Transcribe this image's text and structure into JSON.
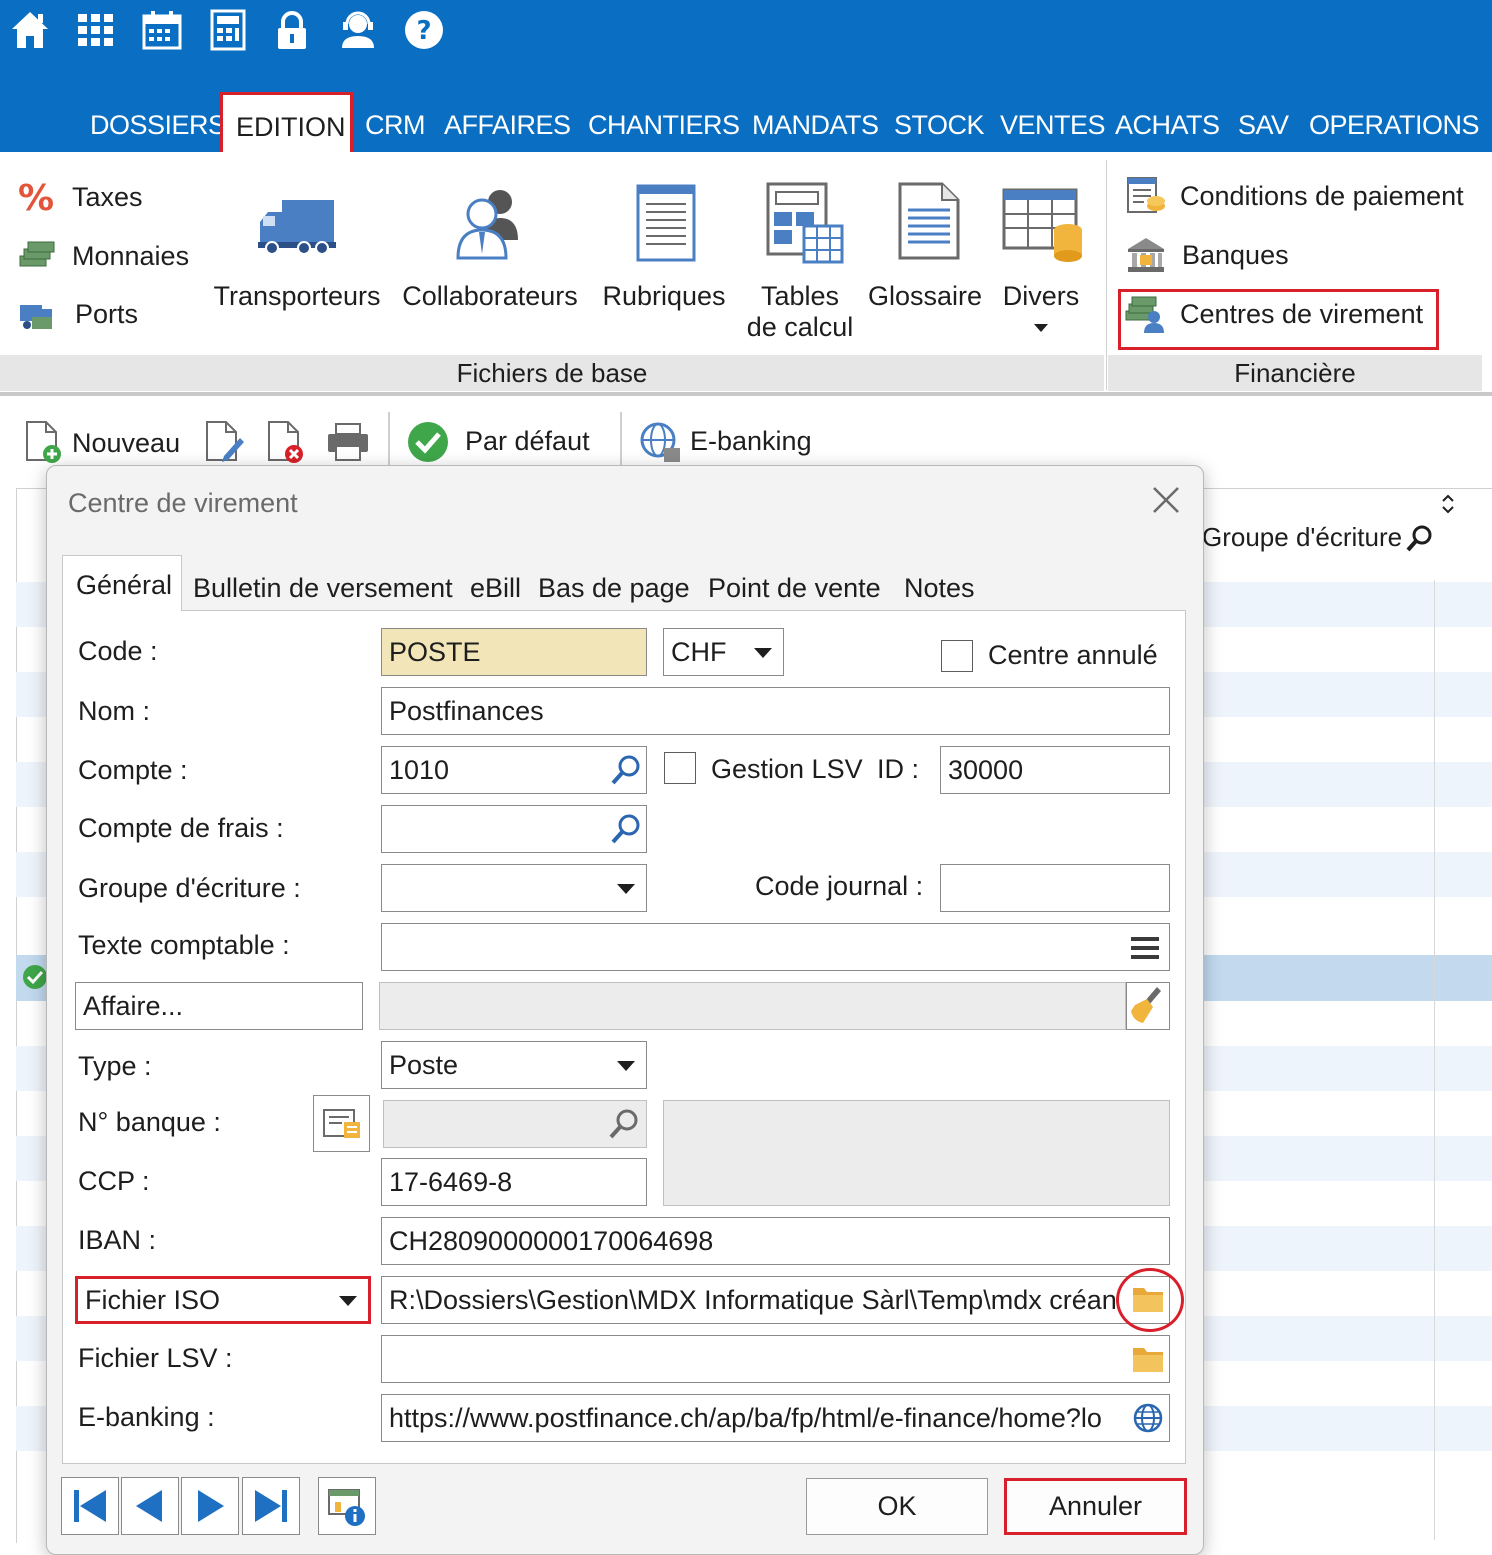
{
  "menu": {
    "items": [
      "DOSSIERS",
      "EDITION",
      "CRM",
      "AFFAIRES",
      "CHANTIERS",
      "MANDATS",
      "STOCK",
      "VENTES",
      "ACHATS",
      "SAV",
      "OPERATIONS"
    ],
    "active": "EDITION"
  },
  "quick_access_icons": [
    "home-icon",
    "apps-grid-icon",
    "calendar-icon",
    "calculator-icon",
    "lock-icon",
    "user-support-icon",
    "help-icon"
  ],
  "ribbon": {
    "fichiers_de_base": {
      "label": "Fichiers de base",
      "small": [
        "Taxes",
        "Monnaies",
        "Ports"
      ],
      "large": [
        {
          "label": "Transporteurs"
        },
        {
          "label": "Collaborateurs"
        },
        {
          "label": "Rubriques"
        },
        {
          "label1": "Tables",
          "label2": "de calcul"
        },
        {
          "label": "Glossaire"
        },
        {
          "label": "Divers"
        }
      ]
    },
    "financiere": {
      "label": "Financière",
      "items": [
        "Conditions de paiement",
        "Banques",
        "Centres de virement"
      ]
    }
  },
  "toolbar": {
    "nouveau": "Nouveau",
    "par_defaut": "Par défaut",
    "ebanking": "E-banking"
  },
  "grid": {
    "header": "Groupe d'écriture"
  },
  "dialog": {
    "title": "Centre de virement",
    "tabs": [
      "Général",
      "Bulletin de versement",
      "eBill",
      "Bas de page",
      "Point de vente",
      "Notes"
    ],
    "labels": {
      "code": "Code :",
      "nom": "Nom :",
      "compte": "Compte :",
      "compte_frais": "Compte de frais :",
      "groupe_ecriture": "Groupe d'écriture :",
      "texte_comptable": "Texte comptable :",
      "affaire": "Affaire...",
      "type": "Type :",
      "no_banque": "N° banque :",
      "ccp": "CCP :",
      "iban": "IBAN :",
      "fichier_iso": "Fichier ISO",
      "fichier_lsv": "Fichier LSV :",
      "ebanking": "E-banking :",
      "centre_annule": "Centre annulé",
      "gestion_lsv": "Gestion LSV",
      "id": "ID :",
      "code_journal": "Code journal :"
    },
    "values": {
      "code": "POSTE",
      "devise": "CHF",
      "nom": "Postfinances",
      "compte": "1010",
      "id": "30000",
      "type": "Poste",
      "ccp": "17-6469-8",
      "iban": "CH2809000000170064698",
      "fichier_iso": "R:\\Dossiers\\Gestion\\MDX Informatique Sàrl\\Temp\\mdx créanci",
      "ebanking": "https://www.postfinance.ch/ap/ba/fp/html/e-finance/home?lo"
    },
    "buttons": {
      "ok": "OK",
      "annuler": "Annuler"
    }
  }
}
